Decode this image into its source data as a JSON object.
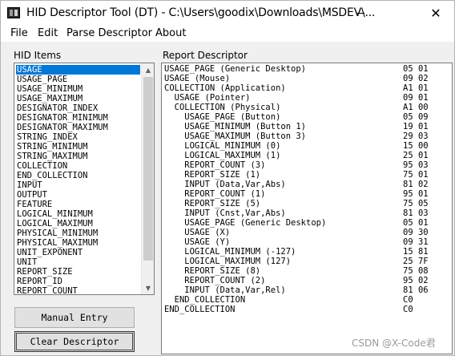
{
  "window": {
    "title": "HID Descriptor Tool (DT) - C:\\Users\\goodix\\Downloads\\MSDEV\\...",
    "minimize_glyph": "—",
    "close_glyph": "✕"
  },
  "menu": [
    "File",
    "Edit",
    "Parse Descriptor",
    "About"
  ],
  "hid_items_panel": {
    "label": "HID Items",
    "selected": "USAGE",
    "items": [
      "USAGE",
      "USAGE_PAGE",
      "USAGE_MINIMUM",
      "USAGE_MAXIMUM",
      "DESIGNATOR_INDEX",
      "DESIGNATOR_MINIMUM",
      "DESIGNATOR_MAXIMUM",
      "STRING_INDEX",
      "STRING_MINIMUM",
      "STRING_MAXIMUM",
      "COLLECTION",
      "END_COLLECTION",
      "INPUT",
      "OUTPUT",
      "FEATURE",
      "LOGICAL_MINIMUM",
      "LOGICAL_MAXIMUM",
      "PHYSICAL_MINIMUM",
      "PHYSICAL_MAXIMUM",
      "UNIT_EXPONENT",
      "UNIT",
      "REPORT_SIZE",
      "REPORT_ID",
      "REPORT_COUNT"
    ],
    "scroll_up_glyph": "▲",
    "scroll_down_glyph": "▼"
  },
  "buttons": {
    "manual_entry": "Manual Entry",
    "clear_descriptor": "Clear Descriptor"
  },
  "report_panel": {
    "label": "Report Descriptor",
    "lines": [
      {
        "text": "USAGE_PAGE (Generic Desktop)",
        "code": "05 01"
      },
      {
        "text": "USAGE (Mouse)",
        "code": "09 02"
      },
      {
        "text": "COLLECTION (Application)",
        "code": "A1 01"
      },
      {
        "text": "  USAGE (Pointer)",
        "code": "09 01"
      },
      {
        "text": "  COLLECTION (Physical)",
        "code": "A1 00"
      },
      {
        "text": "    USAGE_PAGE (Button)",
        "code": "05 09"
      },
      {
        "text": "    USAGE_MINIMUM (Button 1)",
        "code": "19 01"
      },
      {
        "text": "    USAGE_MAXIMUM (Button 3)",
        "code": "29 03"
      },
      {
        "text": "    LOGICAL_MINIMUM (0)",
        "code": "15 00"
      },
      {
        "text": "    LOGICAL_MAXIMUM (1)",
        "code": "25 01"
      },
      {
        "text": "    REPORT_COUNT (3)",
        "code": "95 03"
      },
      {
        "text": "    REPORT_SIZE (1)",
        "code": "75 01"
      },
      {
        "text": "    INPUT (Data,Var,Abs)",
        "code": "81 02"
      },
      {
        "text": "    REPORT_COUNT (1)",
        "code": "95 01"
      },
      {
        "text": "    REPORT_SIZE (5)",
        "code": "75 05"
      },
      {
        "text": "    INPUT (Cnst,Var,Abs)",
        "code": "81 03"
      },
      {
        "text": "    USAGE_PAGE (Generic Desktop)",
        "code": "05 01"
      },
      {
        "text": "    USAGE (X)",
        "code": "09 30"
      },
      {
        "text": "    USAGE (Y)",
        "code": "09 31"
      },
      {
        "text": "    LOGICAL_MINIMUM (-127)",
        "code": "15 81"
      },
      {
        "text": "    LOGICAL_MAXIMUM (127)",
        "code": "25 7F"
      },
      {
        "text": "    REPORT_SIZE (8)",
        "code": "75 08"
      },
      {
        "text": "    REPORT_COUNT (2)",
        "code": "95 02"
      },
      {
        "text": "    INPUT (Data,Var,Rel)",
        "code": "81 06"
      },
      {
        "text": "  END_COLLECTION",
        "code": "C0"
      },
      {
        "text": "END_COLLECTION",
        "code": "C0"
      }
    ]
  },
  "watermark": "CSDN @X-Code君"
}
